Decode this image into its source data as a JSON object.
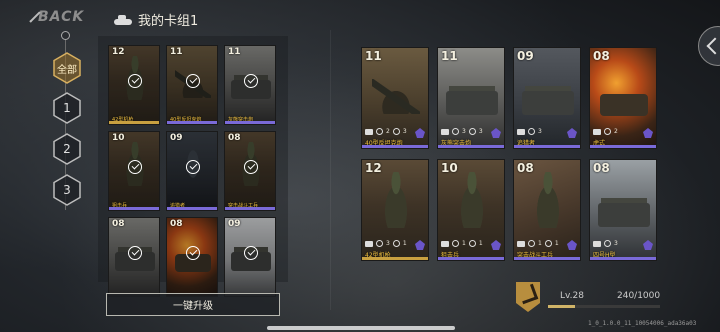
{
  "header": {
    "back_label": "BACK",
    "deck_title": "我的卡组1"
  },
  "filters": [
    {
      "label": "全部",
      "active": true
    },
    {
      "label": "1",
      "active": false
    },
    {
      "label": "2",
      "active": false
    },
    {
      "label": "3",
      "active": false
    }
  ],
  "left_cards": [
    {
      "cost": "12",
      "name": "42型机枪",
      "art": "infantry",
      "bar": "#c8a040",
      "check": true
    },
    {
      "cost": "11",
      "name": "40型反坦克炮",
      "art": "gun",
      "bar": "#7a6ad8",
      "check": true
    },
    {
      "cost": "11",
      "name": "灰熊突击炮",
      "art": "tank",
      "bar": "#7a6ad8",
      "check": true
    },
    {
      "cost": "10",
      "name": "狙击兵",
      "art": "infantry",
      "bar": "#7a6ad8",
      "check": true
    },
    {
      "cost": "09",
      "name": "追猎者",
      "art": "dark",
      "bar": "#7a6ad8",
      "check": true
    },
    {
      "cost": "08",
      "name": "突击战斗工兵",
      "art": "infantry",
      "bar": "#7a6ad8",
      "check": true
    },
    {
      "cost": "08",
      "name": "",
      "art": "tank",
      "bar": "",
      "check": true
    },
    {
      "cost": "08",
      "name": "",
      "art": "fire",
      "bar": "",
      "check": true
    },
    {
      "cost": "09",
      "name": "",
      "art": "snow",
      "bar": "",
      "check": true
    }
  ],
  "right_cards": [
    {
      "cost": "11",
      "name": "40型反坦克炮",
      "art": "gun",
      "bar": "#7a6ad8",
      "stats": [
        "2",
        "3"
      ]
    },
    {
      "cost": "11",
      "name": "灰熊突击炮",
      "art": "tank",
      "bar": "#7a6ad8",
      "stats": [
        "3",
        "3"
      ]
    },
    {
      "cost": "09",
      "name": "追猎者",
      "art": "tank2",
      "bar": "#7a6ad8",
      "stats": [
        "3"
      ]
    },
    {
      "cost": "08",
      "name": "虎式",
      "art": "fire",
      "bar": "#7a6ad8",
      "stats": [
        "2"
      ]
    },
    {
      "cost": "12",
      "name": "42型机枪",
      "art": "infantry",
      "bar": "#c8a040",
      "stats": [
        "3",
        "1"
      ]
    },
    {
      "cost": "10",
      "name": "狙击兵",
      "art": "infantry",
      "bar": "#7a6ad8",
      "stats": [
        "1",
        "1"
      ]
    },
    {
      "cost": "08",
      "name": "突击战斗工兵",
      "art": "infantry2",
      "bar": "#7a6ad8",
      "stats": [
        "1",
        "1"
      ]
    },
    {
      "cost": "08",
      "name": "四号H型",
      "art": "tank3",
      "bar": "#7a6ad8",
      "stats": [
        "3"
      ]
    }
  ],
  "upgrade_button": "一键升级",
  "level": {
    "label": "Lv.28",
    "xp_text": "240/1000",
    "xp_fraction": 0.24
  },
  "version": "1_0_1.0.0_11_10054006_ada36a03",
  "colors": {
    "rare": "#c8a040",
    "epic": "#7a6ad8"
  }
}
